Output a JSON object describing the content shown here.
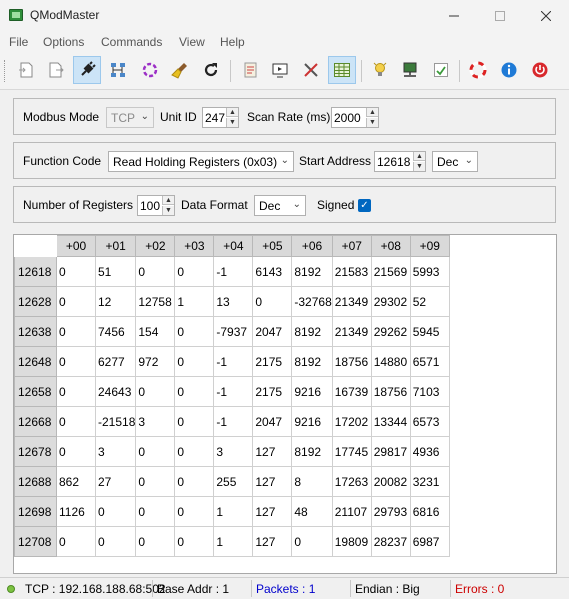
{
  "window": {
    "title": "QModMaster"
  },
  "menu": [
    "File",
    "Options",
    "Commands",
    "View",
    "Help"
  ],
  "toolbar_icons": [
    "connect-doc-icon",
    "disconnect-doc-icon",
    "plug-icon",
    "network-icon",
    "spinner-icon",
    "brush-icon",
    "refresh-icon",
    "log-icon",
    "display-icon",
    "tools-icon",
    "table-icon",
    "bulb-icon",
    "monitor-icon",
    "chart-icon",
    "lifebuoy-icon",
    "info-icon",
    "power-icon"
  ],
  "settings": {
    "modbus_mode_label": "Modbus Mode",
    "modbus_mode_value": "TCP",
    "unit_id_label": "Unit ID",
    "unit_id_value": "247",
    "scan_rate_label": "Scan Rate (ms)",
    "scan_rate_value": "2000",
    "function_code_label": "Function Code",
    "function_code_value": "Read Holding Registers (0x03)",
    "start_address_label": "Start Address",
    "start_address_value": "12618",
    "start_address_format": "Dec",
    "num_registers_label": "Number of Registers",
    "num_registers_value": "100",
    "data_format_label": "Data Format",
    "data_format_value": "Dec",
    "signed_label": "Signed",
    "signed_checked": true
  },
  "grid": {
    "columns": [
      "+00",
      "+01",
      "+02",
      "+03",
      "+04",
      "+05",
      "+06",
      "+07",
      "+08",
      "+09"
    ],
    "rows": [
      {
        "addr": "12618",
        "values": [
          "0",
          "51",
          "0",
          "0",
          "-1",
          "6143",
          "8192",
          "21583",
          "21569",
          "5993"
        ]
      },
      {
        "addr": "12628",
        "values": [
          "0",
          "12",
          "12758",
          "1",
          "13",
          "0",
          "-32768",
          "21349",
          "29302",
          "52"
        ]
      },
      {
        "addr": "12638",
        "values": [
          "0",
          "7456",
          "154",
          "0",
          "-7937",
          "2047",
          "8192",
          "21349",
          "29262",
          "5945"
        ]
      },
      {
        "addr": "12648",
        "values": [
          "0",
          "6277",
          "972",
          "0",
          "-1",
          "2175",
          "8192",
          "18756",
          "14880",
          "6571"
        ]
      },
      {
        "addr": "12658",
        "values": [
          "0",
          "24643",
          "0",
          "0",
          "-1",
          "2175",
          "9216",
          "16739",
          "18756",
          "7103"
        ]
      },
      {
        "addr": "12668",
        "values": [
          "0",
          "-21518",
          "3",
          "0",
          "-1",
          "2047",
          "9216",
          "17202",
          "13344",
          "6573"
        ]
      },
      {
        "addr": "12678",
        "values": [
          "0",
          "3",
          "0",
          "0",
          "3",
          "127",
          "8192",
          "17745",
          "29817",
          "4936"
        ]
      },
      {
        "addr": "12688",
        "values": [
          "862",
          "27",
          "0",
          "0",
          "255",
          "127",
          "8",
          "17263",
          "20082",
          "3231"
        ]
      },
      {
        "addr": "12698",
        "values": [
          "1126",
          "0",
          "0",
          "0",
          "1",
          "127",
          "48",
          "21107",
          "29793",
          "6816"
        ]
      },
      {
        "addr": "12708",
        "values": [
          "0",
          "0",
          "0",
          "0",
          "1",
          "127",
          "0",
          "19809",
          "28237",
          "6987"
        ]
      }
    ]
  },
  "status": {
    "connection": "TCP : 192.168.188.68:502",
    "base_addr": "Base Addr : 1",
    "packets": "Packets : 1",
    "endian": "Endian : Big",
    "errors": "Errors : 0",
    "packets_color": "#0000cc",
    "errors_color": "#cc0000"
  }
}
